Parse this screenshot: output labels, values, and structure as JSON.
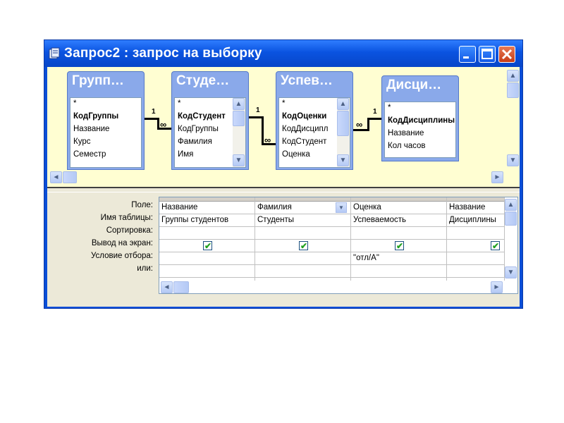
{
  "window": {
    "title": "Запрос2 : запрос на выборку",
    "buttons": {
      "minimize": "minimize-icon",
      "maximize": "maximize-icon",
      "close": "close-icon"
    }
  },
  "tables": [
    {
      "title": "Групп…",
      "fields": [
        "*",
        "КодГруппы",
        "Название",
        "Курс",
        "Семестр"
      ],
      "key": "КодГруппы"
    },
    {
      "title": "Студе…",
      "fields": [
        "*",
        "КодСтудент",
        "КодГруппы",
        "Фамилия",
        "Имя"
      ],
      "key": "КодСтудент"
    },
    {
      "title": "Успев…",
      "fields": [
        "*",
        "КодОценки",
        "КодДисципл",
        "КодСтудент",
        "Оценка"
      ],
      "key": "КодОценки"
    },
    {
      "title": "Дисци…",
      "fields": [
        "*",
        "КодДисциплины",
        "Название",
        "Кол часов"
      ],
      "key": "КодДисциплины"
    }
  ],
  "relations": [
    {
      "one": "1",
      "many": "∞"
    },
    {
      "one": "1",
      "many": "∞"
    },
    {
      "one": "1",
      "many": "∞"
    }
  ],
  "grid": {
    "row_labels": [
      "Поле:",
      "Имя таблицы:",
      "Сортировка:",
      "Вывод на экран:",
      "Условие отбора:",
      "или:"
    ],
    "columns": [
      {
        "field": "Название",
        "table": "Группы студентов",
        "sort": "",
        "show": true,
        "criteria": "",
        "or": ""
      },
      {
        "field": "Фамилия",
        "table": "Студенты",
        "sort": "",
        "show": true,
        "criteria": "",
        "or": ""
      },
      {
        "field": "Оценка",
        "table": "Успеваемость",
        "sort": "",
        "show": true,
        "criteria": "\"отл/А\"",
        "or": ""
      },
      {
        "field": "Название",
        "table": "Дисциплины",
        "sort": "",
        "show": true,
        "criteria": "",
        "or": ""
      }
    ],
    "check_mark": "✔"
  },
  "colors": {
    "titlebar": "#0a53e0",
    "table_header": "#8aa9ea",
    "design_bg": "#fffed2",
    "check": "#21a121"
  }
}
